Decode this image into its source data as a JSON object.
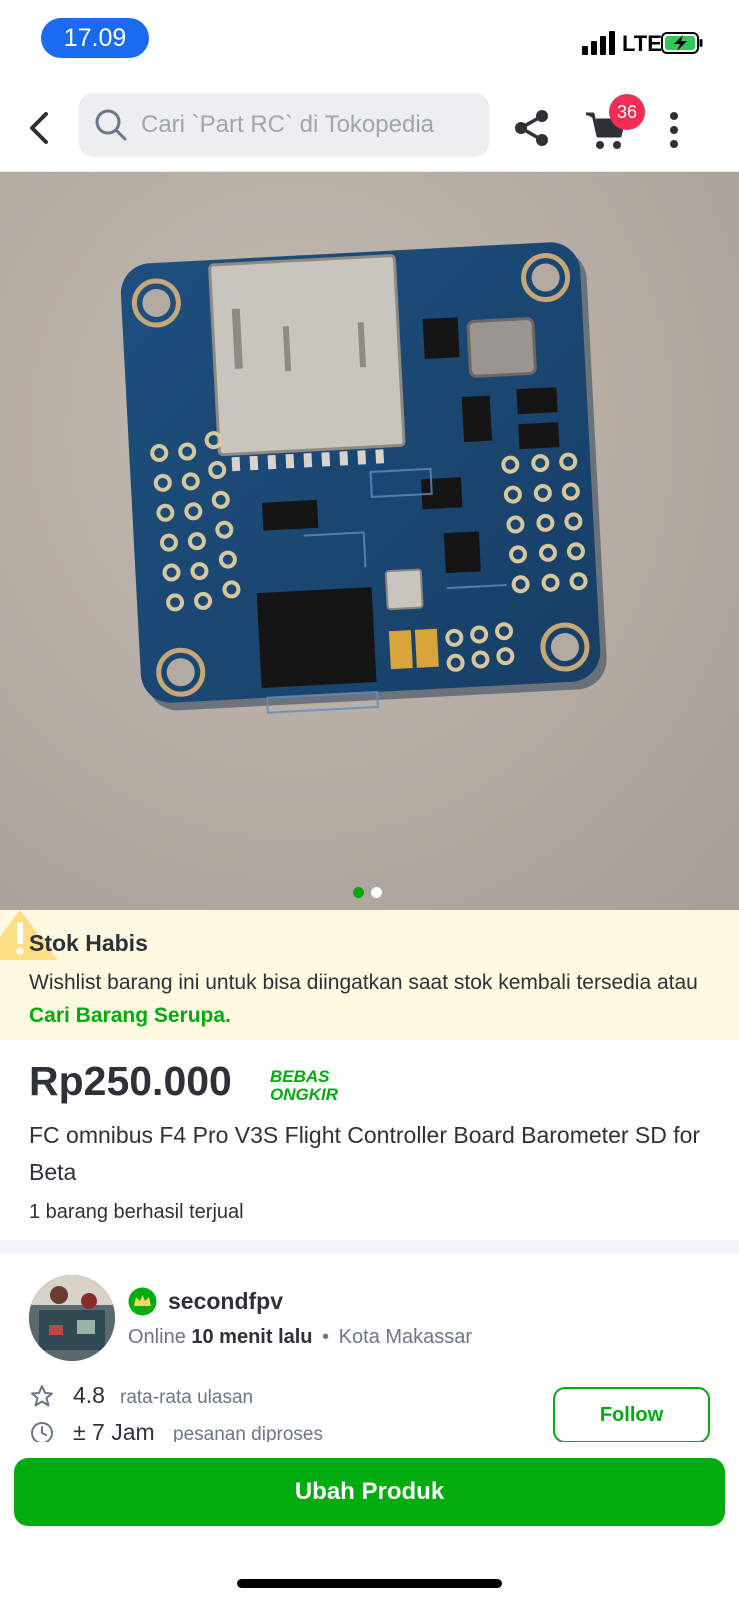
{
  "status_bar": {
    "time": "17.09",
    "network": "LTE"
  },
  "header": {
    "search_placeholder": "Cari `Part RC` di Tokopedia",
    "cart_count": "36"
  },
  "gallery": {
    "image_count": 2,
    "active_index": 0
  },
  "stock_notice": {
    "title": "Stok Habis",
    "description": "Wishlist barang ini untuk bisa diingatkan saat stok kembali tersedia atau ",
    "link_text": "Cari Barang Serupa."
  },
  "product": {
    "price": "Rp250.000",
    "shipping_badge_line1": "BEBAS",
    "shipping_badge_line2": "ONGKIR",
    "title": "FC omnibus F4 Pro V3S Flight Controller Board Barometer SD for Beta",
    "sold": "1 barang berhasil terjual"
  },
  "seller": {
    "name": "secondfpv",
    "online_label": "Online",
    "online_time": "10 menit lalu",
    "separator": "•",
    "location": "Kota Makassar",
    "rating_value": "4.8",
    "rating_label": "rata-rata ulasan",
    "process_value": "± 7 Jam",
    "process_label": "pesanan diproses",
    "follow_label": "Follow"
  },
  "bottom": {
    "primary_label": "Ubah Produk"
  },
  "colors": {
    "accent": "#03ac0e",
    "badge": "#f02d54",
    "time_pill": "#1a6bf0",
    "notice_bg": "#fff9e1"
  }
}
